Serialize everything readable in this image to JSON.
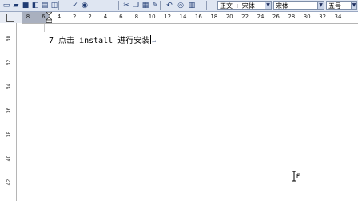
{
  "toolbar": {
    "buttons": [
      {
        "name": "new-document-icon",
        "glyph": "▭"
      },
      {
        "name": "open-folder-icon",
        "glyph": "▰"
      },
      {
        "name": "save-icon",
        "glyph": "■"
      },
      {
        "name": "permission-icon",
        "glyph": "◧"
      },
      {
        "name": "print-icon",
        "glyph": "▤"
      },
      {
        "name": "print-preview-icon",
        "glyph": "◫"
      },
      {
        "name": "spelling-icon",
        "glyph": "✓"
      },
      {
        "name": "research-icon",
        "glyph": "◉"
      },
      {
        "name": "cut-icon",
        "glyph": "✂"
      },
      {
        "name": "copy-icon",
        "glyph": "❐"
      },
      {
        "name": "paste-icon",
        "glyph": "▦"
      },
      {
        "name": "format-painter-icon",
        "glyph": "✎"
      },
      {
        "name": "undo-icon",
        "glyph": "↶"
      },
      {
        "name": "hyperlink-icon",
        "glyph": "◎"
      },
      {
        "name": "table-icon",
        "glyph": "▥"
      }
    ],
    "style_combo": "正文 + 宋体",
    "font_combo": "宋体",
    "size_combo": "五号"
  },
  "ruler": {
    "horizontal_labels": [
      "8",
      "6",
      "4",
      "2",
      "2",
      "4",
      "6",
      "8",
      "10",
      "12",
      "14",
      "16",
      "18",
      "20",
      "22",
      "24",
      "26",
      "28",
      "30",
      "32",
      "34"
    ],
    "vertical_labels": [
      "30",
      "32",
      "34",
      "36",
      "38",
      "40",
      "42"
    ]
  },
  "document": {
    "line_text": "7 点击 install 进行安装",
    "para_mark": "↵"
  }
}
